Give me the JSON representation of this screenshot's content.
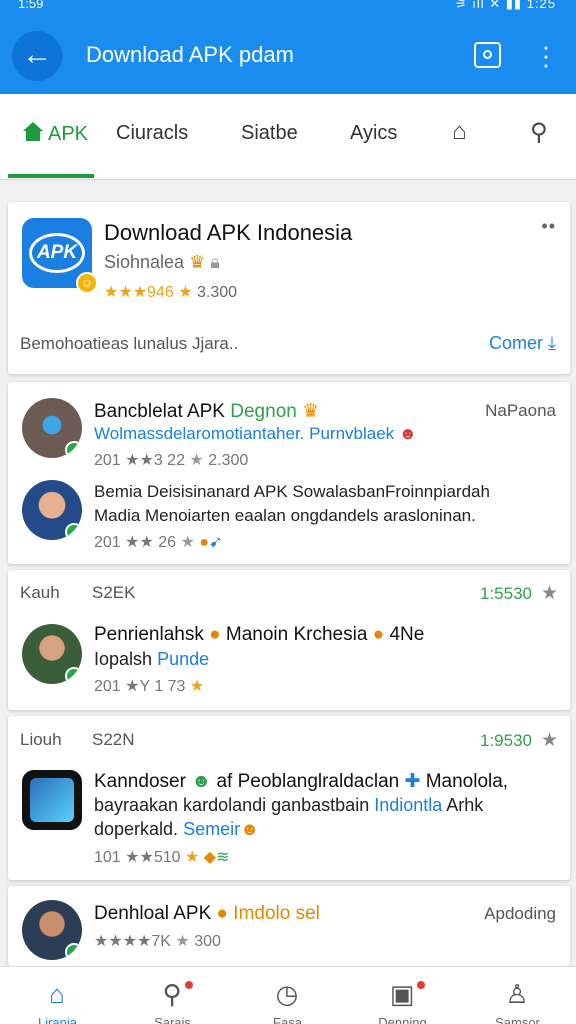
{
  "status": {
    "time": "1:59",
    "right": "⚞ ıll ✕ ▮▮ 1:25"
  },
  "appbar": {
    "title": "Download APK pdam"
  },
  "tabs": [
    {
      "label": "APK"
    },
    {
      "label": "Ciuracls"
    },
    {
      "label": "Siatbe"
    },
    {
      "label": "Ayics"
    }
  ],
  "featured": {
    "logo_text": "APK",
    "title": "Download APK Indonesia",
    "subtitle": "Siohnalea",
    "rating_text": "★★★946",
    "rating_count": "3.300",
    "footer": "Bemohoatieas   lunalus   Jjara..",
    "cta": "Comer"
  },
  "list1": {
    "item1": {
      "title_black": "Bancblelat APK",
      "title_green": "Degnon",
      "right": "NaPaona",
      "subtitle": "Wolmassdelaromotiantaher. Purnvblaek",
      "rating_text": "201 ★★3 22",
      "rating_count": "2.300"
    },
    "item2": {
      "line1": "Bemia Deisisinanard APK SowalasbanFroinnpiardah",
      "line2": "Madia Menoiarten eaalan ongdandels arasloninan.",
      "rating_text": "201 ★★ 26"
    }
  },
  "list2": {
    "meta_left": "Kauh",
    "meta_size": "S2EK",
    "meta_right": "1:5530",
    "title_a": "Penrienlahsk",
    "title_b": "Manoin Krchesia",
    "title_c": "4Ne",
    "sub_black": "Iopalsh",
    "sub_blue": "Punde",
    "rating_text": "201 ★Y 1 73"
  },
  "list3": {
    "meta_left": "Liouh",
    "meta_size": "S22N",
    "meta_right": "1:9530",
    "line1_a": "Kanndoser",
    "line1_b": "af Peoblanglraldaclan",
    "line1_c": "Manolola,",
    "line2_black": "bayraakan kardolandi ganbastbain",
    "line2_blue": "Indiontla",
    "line2_tail": "Arhk",
    "line3_black": "doperkald.",
    "line3_blue": "Semeir",
    "rating_text": "101 ★★510"
  },
  "list4": {
    "title_black": "Denhloal APK",
    "title_orange": "Imdolo sel",
    "right": "Apdoding",
    "rating_text": "★★★★7K",
    "rating_count": "300"
  },
  "nav": [
    {
      "label": "Lirania"
    },
    {
      "label": "Sarais"
    },
    {
      "label": "Fasa"
    },
    {
      "label": "Denning"
    },
    {
      "label": "Samsor"
    }
  ],
  "colors": {
    "primary": "#1a8cf0",
    "accent_green": "#1e9b3d",
    "star": "#f0a21a"
  }
}
